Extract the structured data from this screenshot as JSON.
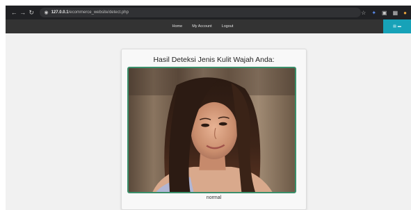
{
  "browser": {
    "url_host": "127.0.0.1",
    "url_path": "/ecommerce_website/detect.php",
    "back_icon": "arrow-left-icon",
    "forward_icon": "arrow-right-icon",
    "reload_icon": "reload-icon",
    "site_icon": "site-info-icon"
  },
  "nav": {
    "links": [
      "Home",
      "My Account",
      "Logout"
    ]
  },
  "card": {
    "title": "Hasil Deteksi Jenis Kulit Wajah Anda:",
    "result": "normal",
    "image_alt": "detected face photo"
  },
  "colors": {
    "navbar": "#333333",
    "cart_accent": "#17a2b8",
    "frame_border": "#3a8f6a",
    "page_bg": "#f1f1f1"
  }
}
